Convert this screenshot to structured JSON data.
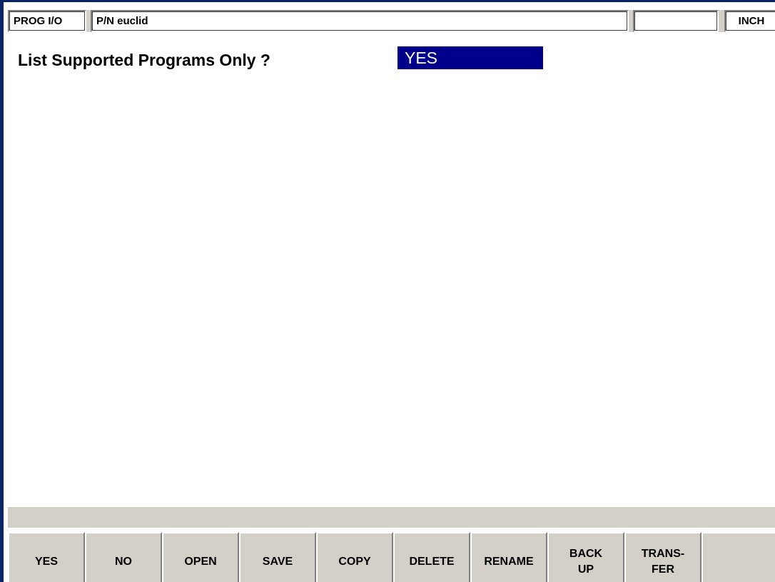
{
  "status_bar": {
    "mode": "PROG I/O",
    "part_number": "P/N euclid",
    "blank": "",
    "units": "INCH"
  },
  "prompt": {
    "label": "List Supported Programs Only ?",
    "value": "YES"
  },
  "message_bar": {
    "text": ""
  },
  "softkeys": [
    {
      "label": "YES"
    },
    {
      "label": "NO"
    },
    {
      "label": "OPEN"
    },
    {
      "label": "SAVE"
    },
    {
      "label": "COPY"
    },
    {
      "label": "DELETE"
    },
    {
      "label": "RENAME"
    },
    {
      "label": "BACK\nUP"
    },
    {
      "label": "TRANS-\nFER"
    },
    {
      "label": ""
    }
  ],
  "colors": {
    "highlight": "#00008b",
    "frame": "#0a246a",
    "panel": "#d4d0c8"
  }
}
